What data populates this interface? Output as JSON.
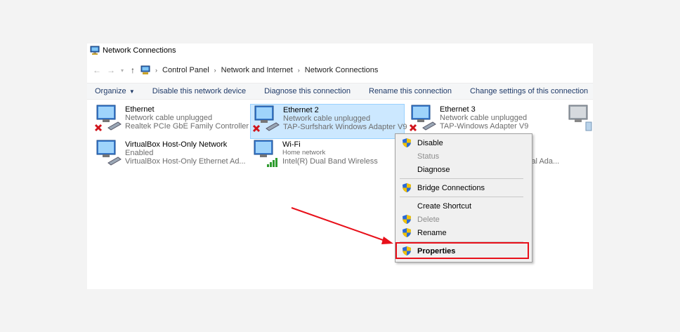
{
  "window": {
    "title": "Network Connections"
  },
  "address_bar": {
    "breadcrumbs": [
      "Control Panel",
      "Network and Internet",
      "Network Connections"
    ]
  },
  "toolbar": {
    "organize": "Organize",
    "disable": "Disable this network device",
    "diagnose": "Diagnose this connection",
    "rename": "Rename this connection",
    "change": "Change settings of this connection"
  },
  "connections": [
    {
      "name": "Ethernet",
      "status": "Network cable unplugged",
      "adapter": "Realtek PCIe GbE Family Controller"
    },
    {
      "name": "Ethernet 2",
      "status": "Network cable unplugged",
      "adapter": "TAP-Surfshark Windows Adapter V9"
    },
    {
      "name": "Ethernet 3",
      "status": "Network cable unplugged",
      "adapter": "TAP-Windows Adapter V9"
    },
    {
      "name": "VirtualBox Host-Only Network",
      "status": "Enabled",
      "adapter": "VirtualBox Host-Only Ethernet Ad..."
    },
    {
      "name": "Wi-Fi",
      "status": "Home network",
      "adapter": "Intel(R) Dual Band Wireless"
    },
    {
      "name": "",
      "status": "",
      "adapter": "ial Ada..."
    }
  ],
  "context_menu": {
    "disable": "Disable",
    "status": "Status",
    "diagnose": "Diagnose",
    "bridge": "Bridge Connections",
    "shortcut": "Create Shortcut",
    "delete": "Delete",
    "rename": "Rename",
    "properties": "Properties"
  },
  "colors": {
    "selection_bg": "#cce8ff",
    "highlight": "#e8101a",
    "link_text": "#1f3a68"
  }
}
